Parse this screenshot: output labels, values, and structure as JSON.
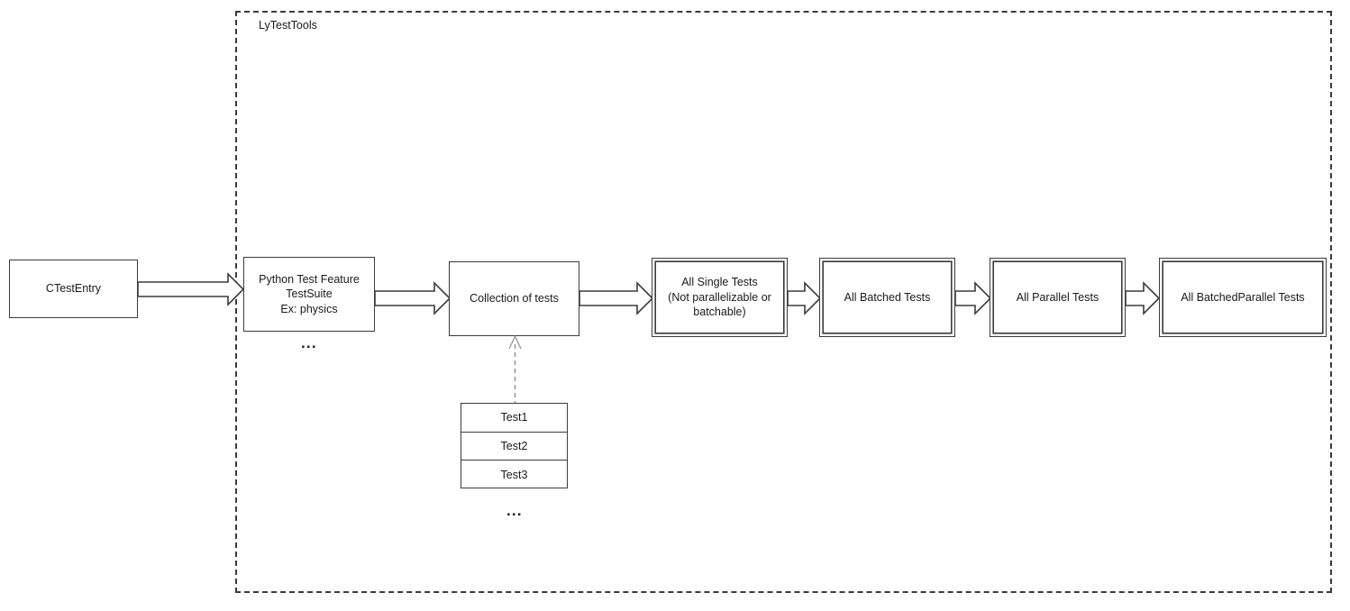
{
  "diagram": {
    "type": "flowchart",
    "group": {
      "label": "LyTestTools",
      "border_style": "dashed",
      "border_color": "#3b3b3b"
    },
    "nodes": [
      {
        "id": "ctestentry",
        "label": "CTestEntry",
        "style": "single"
      },
      {
        "id": "python-suite",
        "label": "Python Test Feature\nTestSuite\nEx: physics",
        "style": "single"
      },
      {
        "id": "collection",
        "label": "Collection of tests",
        "style": "single"
      },
      {
        "id": "single-tests",
        "label": "All Single Tests\n(Not parallelizable or\nbatchable)",
        "style": "double"
      },
      {
        "id": "batched-tests",
        "label": "All Batched Tests",
        "style": "double"
      },
      {
        "id": "parallel-tests",
        "label": "All Parallel Tests",
        "style": "double"
      },
      {
        "id": "batchedparallel",
        "label": "All BatchedParallel Tests",
        "style": "double"
      }
    ],
    "test_stack": {
      "rows": [
        "Test1",
        "Test2",
        "Test3"
      ],
      "more": "..."
    },
    "suite_more": "...",
    "colors": {
      "stroke": "#3b3b3b",
      "text": "#1a1a1a",
      "dashed_connector": "#9a9a9a",
      "background": "#ffffff"
    }
  }
}
